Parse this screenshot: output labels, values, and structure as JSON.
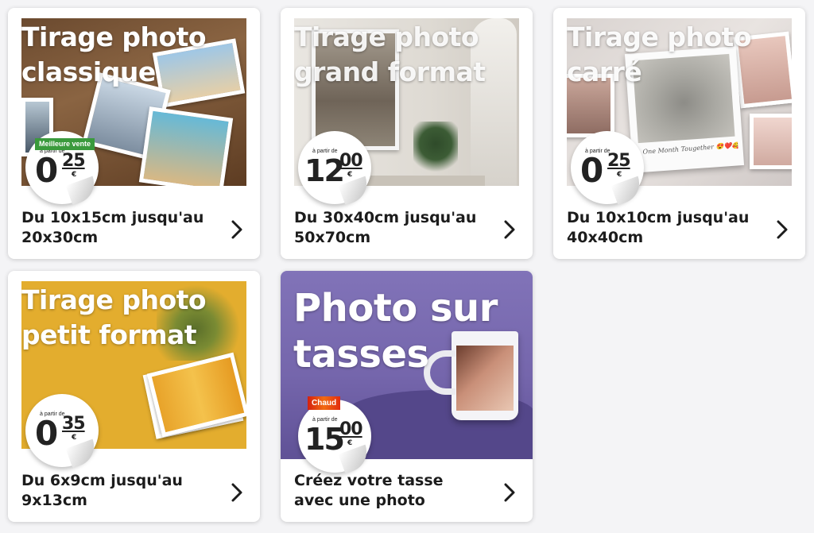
{
  "colors": {
    "page_bg": "#f4f4f6",
    "card_bg": "#ffffff",
    "caption_text": "#1c1c1c",
    "mug_bg": "#7a6cb0",
    "small_format_bg": "#e3ad2e",
    "badge_green": "#3a9a3c",
    "badge_hot": "#e1380f"
  },
  "cards": [
    {
      "title": "Tirage photo\nclassique",
      "badge": "Meilleure vente",
      "price_prefix": "à partir de",
      "price_int": "0",
      "price_dec": "25",
      "price_currency": "€",
      "caption": "Du 10x15cm jusqu'au\n20x30cm",
      "icon": "chevron-right-icon"
    },
    {
      "title": "Tirage photo\ngrand format",
      "price_prefix": "à partir de",
      "price_int": "12",
      "price_dec": "00",
      "price_currency": "€",
      "caption": "Du 30x40cm jusqu'au\n50x70cm",
      "icon": "chevron-right-icon"
    },
    {
      "title": "Tirage photo\ncarré",
      "price_prefix": "à partir de",
      "price_int": "0",
      "price_dec": "25",
      "price_currency": "€",
      "polaroid_text": "One Month Tougether 😍❤️🥰",
      "caption": "Du 10x10cm jusqu'au\n40x40cm",
      "icon": "chevron-right-icon"
    },
    {
      "title": "Tirage photo\npetit format",
      "price_prefix": "à partir de",
      "price_int": "0",
      "price_dec": "35",
      "price_currency": "€",
      "caption": "Du 6x9cm jusqu'au\n9x13cm",
      "icon": "chevron-right-icon"
    },
    {
      "title": "Photo sur\ntasses",
      "badge": "Chaud",
      "price_prefix": "à partir de",
      "price_int": "15",
      "price_dec": "00",
      "price_currency": "€",
      "caption": "Créez votre tasse\navec une photo",
      "icon": "chevron-right-icon"
    }
  ]
}
